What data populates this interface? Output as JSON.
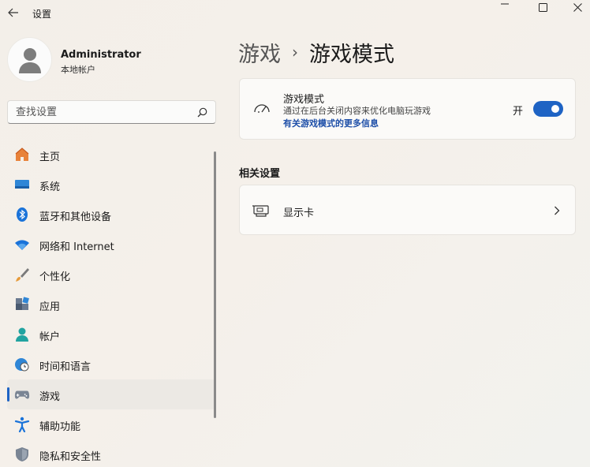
{
  "app": {
    "title": "设置"
  },
  "window": {
    "minimize": "minimize",
    "maximize": "maximize",
    "close": "close"
  },
  "profile": {
    "name": "Administrator",
    "account_type": "本地帐户"
  },
  "search": {
    "placeholder": "查找设置"
  },
  "sidebar": {
    "items": [
      {
        "label": "主页",
        "icon": "home-icon",
        "active": false
      },
      {
        "label": "系统",
        "icon": "monitor-icon",
        "active": false
      },
      {
        "label": "蓝牙和其他设备",
        "icon": "bluetooth-icon",
        "active": false
      },
      {
        "label": "网络和 Internet",
        "icon": "wifi-icon",
        "active": false
      },
      {
        "label": "个性化",
        "icon": "brush-icon",
        "active": false
      },
      {
        "label": "应用",
        "icon": "apps-icon",
        "active": false
      },
      {
        "label": "帐户",
        "icon": "account-icon",
        "active": false
      },
      {
        "label": "时间和语言",
        "icon": "globe-clock-icon",
        "active": false
      },
      {
        "label": "游戏",
        "icon": "gamepad-icon",
        "active": true
      },
      {
        "label": "辅助功能",
        "icon": "accessibility-icon",
        "active": false
      },
      {
        "label": "隐私和安全性",
        "icon": "shield-icon",
        "active": false
      }
    ]
  },
  "breadcrumb": {
    "parent": "游戏",
    "separator": "›",
    "current": "游戏模式"
  },
  "game_mode": {
    "title": "游戏模式",
    "description": "通过在后台关闭内容来优化电脑玩游戏",
    "link": "有关游戏模式的更多信息",
    "toggle_label": "开",
    "toggle_on": true
  },
  "related": {
    "title": "相关设置",
    "graphics_label": "显示卡"
  },
  "colors": {
    "accent": "#1e63c4",
    "link": "#1e4fa8"
  }
}
